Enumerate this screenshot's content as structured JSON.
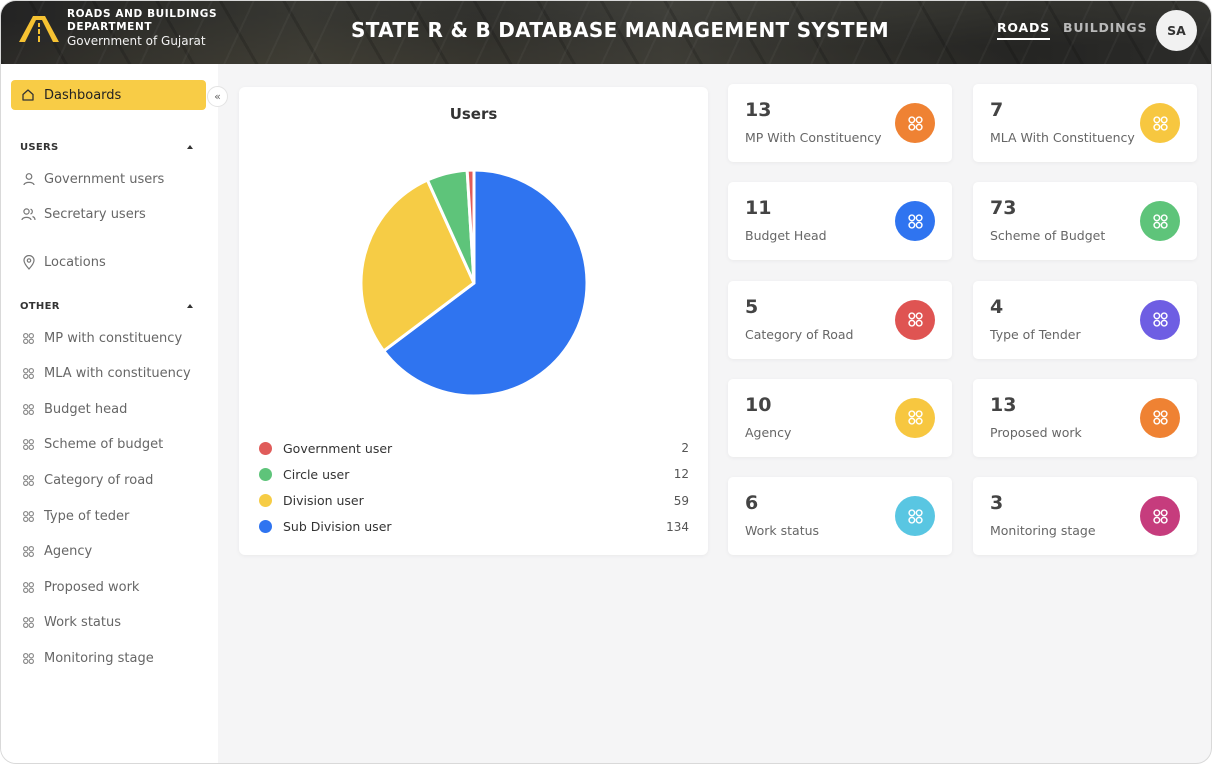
{
  "header": {
    "dept_line1": "ROADS AND BUILDINGS",
    "dept_line2": "DEPARTMENT",
    "dept_line3": "Government of Gujarat",
    "title": "STATE R & B DATABASE MANAGEMENT SYSTEM",
    "nav": {
      "roads": "ROADS",
      "buildings": "BUILDINGS"
    },
    "avatar": "SA"
  },
  "sidebar": {
    "dashboard": "Dashboards",
    "collapse_icon": "«",
    "users_section": "USERS",
    "users_items": [
      {
        "label": "Government users",
        "icon": "user-icon"
      },
      {
        "label": "Secretary users",
        "icon": "users-icon"
      }
    ],
    "locations": "Locations",
    "other_section": "OTHER",
    "other_items": [
      "MP with constituency",
      "MLA with constituency",
      "Budget head",
      "Scheme of budget",
      "Category of road",
      "Type of teder",
      "Agency",
      "Proposed work",
      "Work status",
      "Monitoring stage"
    ]
  },
  "users_panel": {
    "title": "Users",
    "legend": [
      {
        "label": "Government user",
        "value": "2",
        "color": "#e05c5a"
      },
      {
        "label": "Circle user",
        "value": "12",
        "color": "#5ec47a"
      },
      {
        "label": "Division user",
        "value": "59",
        "color": "#f6cc45"
      },
      {
        "label": "Sub Division user",
        "value": "134",
        "color": "#2f74f0"
      }
    ]
  },
  "chart_data": {
    "type": "pie",
    "title": "Users",
    "categories": [
      "Government user",
      "Circle user",
      "Division user",
      "Sub Division user"
    ],
    "values": [
      2,
      12,
      59,
      134
    ],
    "colors": [
      "#e05c5a",
      "#5ec47a",
      "#f6cc45",
      "#2f74f0"
    ]
  },
  "stats": [
    {
      "value": "13",
      "label": "MP With Constituency",
      "color": "#ef8233"
    },
    {
      "value": "7",
      "label": "MLA With Constituency",
      "color": "#f7c740"
    },
    {
      "value": "11",
      "label": "Budget Head",
      "color": "#2f74f0"
    },
    {
      "value": "73",
      "label": "Scheme of Budget",
      "color": "#5ec47a"
    },
    {
      "value": "5",
      "label": "Category of Road",
      "color": "#df5452"
    },
    {
      "value": "4",
      "label": "Type of Tender",
      "color": "#6e5ee3"
    },
    {
      "value": "10",
      "label": "Agency",
      "color": "#f7c740"
    },
    {
      "value": "13",
      "label": "Proposed work",
      "color": "#ef8233"
    },
    {
      "value": "6",
      "label": "Work status",
      "color": "#59c6e2"
    },
    {
      "value": "3",
      "label": "Monitoring stage",
      "color": "#c63c7d"
    }
  ]
}
